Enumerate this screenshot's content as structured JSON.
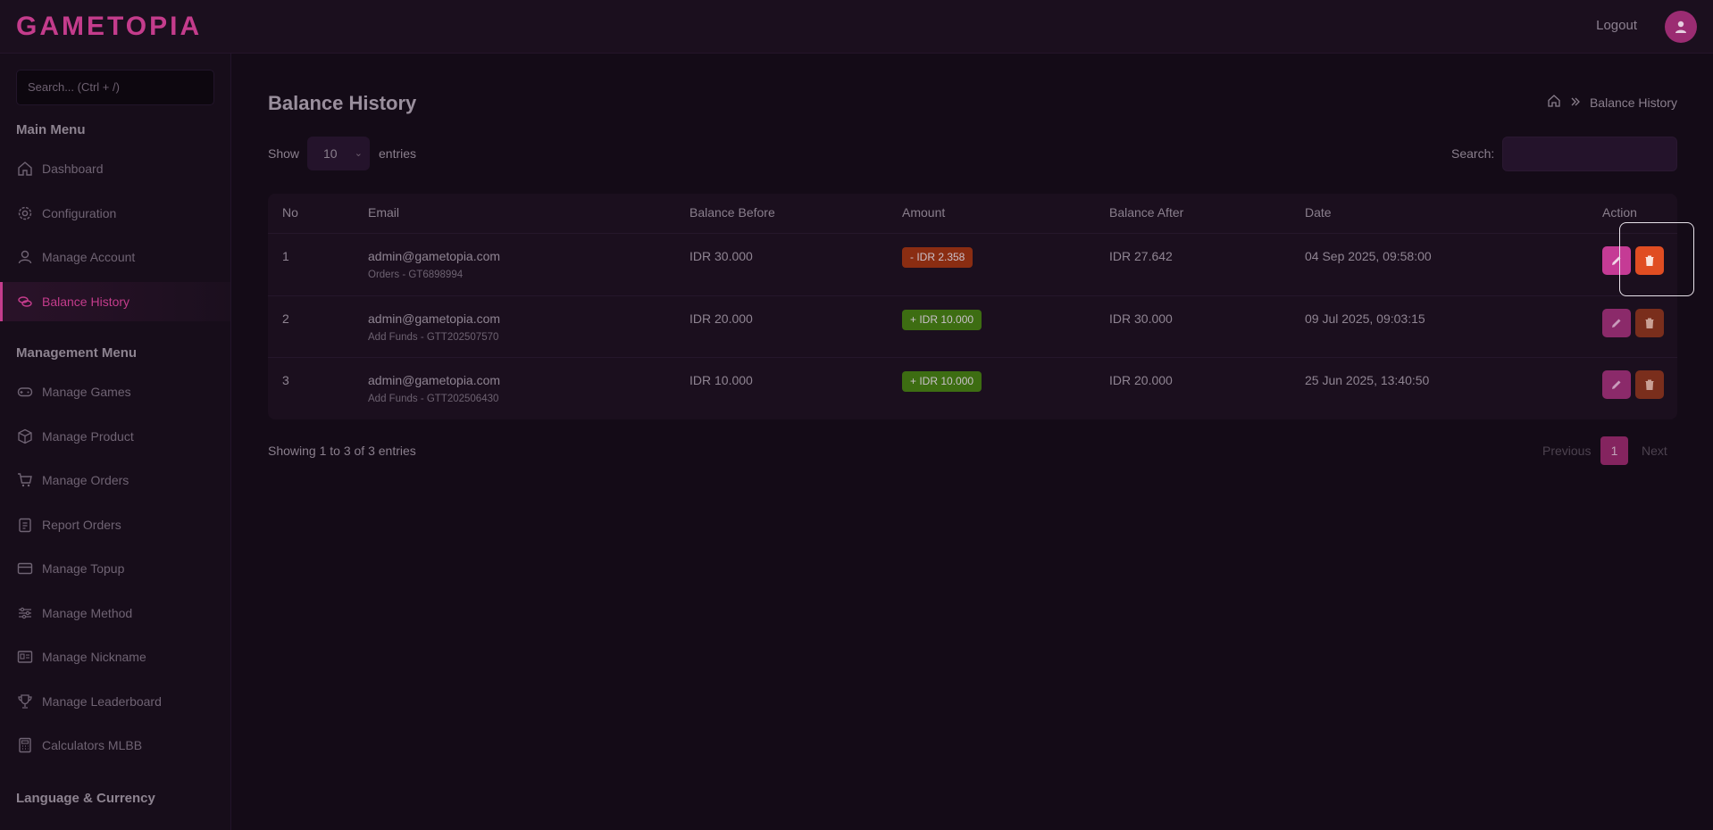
{
  "header": {
    "logo": "GAMETOPIA",
    "logout": "Logout",
    "avatar_icon": "user-icon"
  },
  "sidebar": {
    "search_placeholder": "Search... (Ctrl + /)",
    "main_menu_title": "Main Menu",
    "main_items": [
      {
        "label": "Dashboard",
        "icon": "home-icon"
      },
      {
        "label": "Configuration",
        "icon": "gear-icon"
      },
      {
        "label": "Manage Account",
        "icon": "user-icon"
      },
      {
        "label": "Balance History",
        "icon": "coins-icon",
        "active": true
      }
    ],
    "management_menu_title": "Management Menu",
    "management_items": [
      {
        "label": "Manage Games",
        "icon": "gamepad-icon"
      },
      {
        "label": "Manage Product",
        "icon": "box-icon"
      },
      {
        "label": "Manage Orders",
        "icon": "cart-icon"
      },
      {
        "label": "Report Orders",
        "icon": "clipboard-icon"
      },
      {
        "label": "Manage Topup",
        "icon": "card-icon"
      },
      {
        "label": "Manage Method",
        "icon": "sliders-icon"
      },
      {
        "label": "Manage Nickname",
        "icon": "id-card-icon"
      },
      {
        "label": "Manage Leaderboard",
        "icon": "trophy-icon"
      },
      {
        "label": "Calculators MLBB",
        "icon": "calculator-icon"
      }
    ],
    "language_title": "Language & Currency"
  },
  "main": {
    "title": "Balance History",
    "breadcrumb": {
      "current": "Balance History"
    },
    "show_label": "Show",
    "entries_value": "10",
    "entries_label": "entries",
    "search_label": "Search:",
    "search_value": "",
    "table": {
      "columns": [
        "No",
        "Email",
        "Balance Before",
        "Amount",
        "Balance After",
        "Date",
        "Action"
      ],
      "rows": [
        {
          "no": "1",
          "email": "admin@gametopia.com",
          "note": "Orders - GT6898994",
          "before": "IDR 30.000",
          "amount": "- IDR 2.358",
          "amount_type": "negative",
          "after": "IDR 27.642",
          "date": "04 Sep 2025, 09:58:00"
        },
        {
          "no": "2",
          "email": "admin@gametopia.com",
          "note": "Add Funds - GTT202507570",
          "before": "IDR 20.000",
          "amount": "+ IDR 10.000",
          "amount_type": "positive",
          "after": "IDR 30.000",
          "date": "09 Jul 2025, 09:03:15"
        },
        {
          "no": "3",
          "email": "admin@gametopia.com",
          "note": "Add Funds - GTT202506430",
          "before": "IDR 10.000",
          "amount": "+ IDR 10.000",
          "amount_type": "positive",
          "after": "IDR 20.000",
          "date": "25 Jun 2025, 13:40:50"
        }
      ]
    },
    "footer": {
      "showing": "Showing 1 to 3 of 3 entries",
      "previous": "Previous",
      "page": "1",
      "next": "Next"
    }
  },
  "colors": {
    "accent": "#c43c8c",
    "background": "#140b17",
    "negative_badge": "#8a2d12",
    "positive_badge": "#3d6d12"
  }
}
